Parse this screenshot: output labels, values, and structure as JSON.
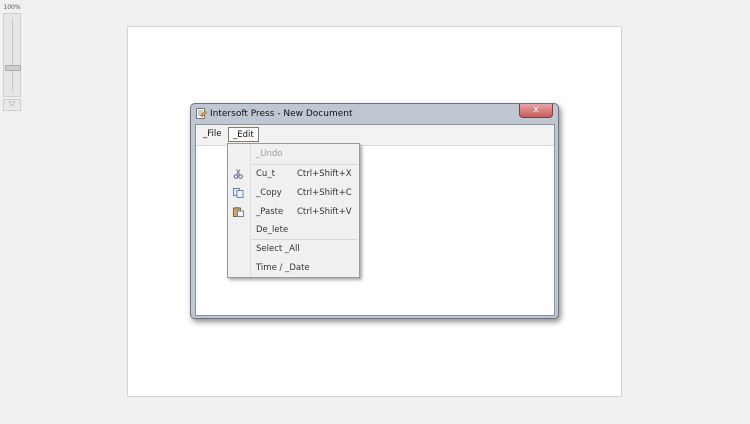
{
  "zoom": {
    "level_label": "100%",
    "level_percent": 100,
    "reset_label": "⤧"
  },
  "window": {
    "title": "Intersoft Press - New Document",
    "close_label": "x"
  },
  "menubar": {
    "file_label": "_File",
    "edit_label": "_Edit"
  },
  "edit_menu": {
    "items": [
      {
        "label": "_Undo",
        "shortcut": "",
        "icon": "",
        "disabled": true
      },
      {
        "label": "Cu_t",
        "shortcut": "Ctrl+Shift+X",
        "icon": "scissors-icon"
      },
      {
        "label": "_Copy",
        "shortcut": "Ctrl+Shift+C",
        "icon": "copy-icon"
      },
      {
        "label": "_Paste",
        "shortcut": "Ctrl+Shift+V",
        "icon": "paste-icon"
      },
      {
        "label": "De_lete",
        "shortcut": "",
        "icon": ""
      },
      {
        "label": "Select _All",
        "shortcut": "",
        "icon": ""
      },
      {
        "label": "Time / _Date",
        "shortcut": "",
        "icon": ""
      }
    ]
  }
}
